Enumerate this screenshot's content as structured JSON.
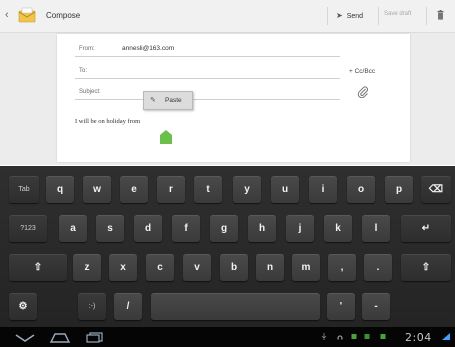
{
  "actionbar": {
    "back_icon": "chevron-left-icon",
    "app_icon": "email-icon",
    "title": "Compose",
    "send_label": "Send",
    "send_icon": "send-icon",
    "save_draft_label": "Save draft",
    "trash_icon": "trash-icon"
  },
  "compose": {
    "from_label": "From:",
    "from_value": "annesli@163.com",
    "to_placeholder": "To:",
    "subject_placeholder": "Subject:",
    "cc_bcc_label": "+ Cc/Bcc",
    "attach_icon": "paperclip-icon",
    "body_text": "I will be on holiday from",
    "paste_label": "Paste",
    "accent_color": "#6bbf4a"
  },
  "keyboard": {
    "row1": [
      {
        "label": "Tab"
      },
      {
        "label": "q"
      },
      {
        "label": "w"
      },
      {
        "label": "e"
      },
      {
        "label": "r"
      },
      {
        "label": "t"
      },
      {
        "label": "y"
      },
      {
        "label": "u"
      },
      {
        "label": "i"
      },
      {
        "label": "o"
      },
      {
        "label": "p"
      },
      {
        "label": "⌫",
        "icon": "backspace-icon"
      }
    ],
    "row2": [
      {
        "label": "?123"
      },
      {
        "label": "a"
      },
      {
        "label": "s"
      },
      {
        "label": "d"
      },
      {
        "label": "f"
      },
      {
        "label": "g"
      },
      {
        "label": "h"
      },
      {
        "label": "j"
      },
      {
        "label": "k"
      },
      {
        "label": "l"
      },
      {
        "label": "↵",
        "icon": "enter-icon"
      }
    ],
    "row3": [
      {
        "label": "⇧",
        "icon": "shift-icon"
      },
      {
        "label": "z"
      },
      {
        "label": "x"
      },
      {
        "label": "c"
      },
      {
        "label": "v"
      },
      {
        "label": "b"
      },
      {
        "label": "n"
      },
      {
        "label": "m"
      },
      {
        "label": ","
      },
      {
        "label": "."
      },
      {
        "label": "⇧",
        "icon": "shift-icon"
      }
    ],
    "row4": [
      {
        "label": "⚙",
        "icon": "settings-icon"
      },
      {
        "label": ":-)"
      },
      {
        "label": "/"
      },
      {
        "label": "",
        "icon": "space-bar"
      },
      {
        "label": "'"
      },
      {
        "label": "-"
      }
    ]
  },
  "systembar": {
    "time": "2:04",
    "nav_icons": [
      "back-nav-icon",
      "home-nav-icon",
      "recent-apps-icon"
    ]
  }
}
